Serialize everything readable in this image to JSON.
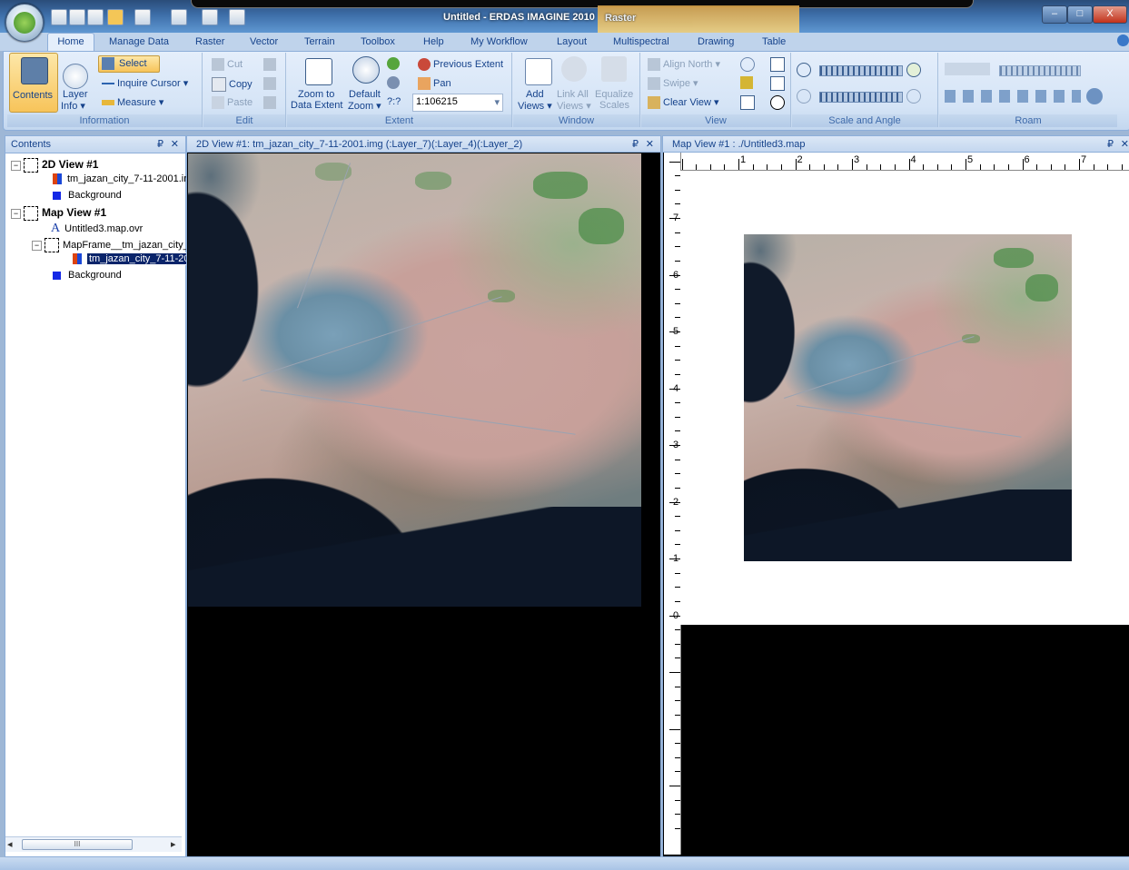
{
  "app": {
    "title": "Untitled - ERDAS IMAGINE 2010",
    "context_tab": "Raster",
    "window_buttons": {
      "minimize": "–",
      "maximize": "□",
      "close": "X"
    }
  },
  "tabs": [
    "Home",
    "Manage Data",
    "Raster",
    "Vector",
    "Terrain",
    "Toolbox",
    "Help",
    "My Workflow",
    "Layout",
    "Multispectral",
    "Drawing",
    "Table"
  ],
  "ribbon": {
    "information": {
      "label": "Information",
      "contents": "Contents",
      "layer_info_1": "Layer",
      "layer_info_2": "Info ▾",
      "select": "Select",
      "inquire_cursor": "Inquire Cursor ▾",
      "measure": "Measure ▾"
    },
    "edit": {
      "label": "Edit",
      "cut": "Cut",
      "copy": "Copy",
      "paste": "Paste"
    },
    "extent": {
      "label": "Extent",
      "zoom_to_1": "Zoom to",
      "zoom_to_2": "Data Extent",
      "default_zoom_1": "Default",
      "default_zoom_2": "Zoom ▾",
      "previous_extent": "Previous Extent",
      "pan": "Pan",
      "scale_prefix": "?:?",
      "scale_value": "1:106215"
    },
    "window": {
      "label": "Window",
      "add_views_1": "Add",
      "add_views_2": "Views ▾",
      "link_all_1": "Link All",
      "link_all_2": "Views ▾",
      "equalize_1": "Equalize",
      "equalize_2": "Scales"
    },
    "view": {
      "label": "View",
      "align_north": "Align North ▾",
      "swipe": "Swipe ▾",
      "clear_view": "Clear View ▾"
    },
    "scale_and_angle": {
      "label": "Scale and Angle"
    },
    "roam": {
      "label": "Roam"
    }
  },
  "contents": {
    "title": "Contents",
    "pin": "₽",
    "close": "✕",
    "tree": [
      {
        "label": "2D View #1",
        "kind": "view"
      },
      {
        "label": "tm_jazan_city_7-11-2001.ir",
        "kind": "layer"
      },
      {
        "label": "Background",
        "kind": "background"
      },
      {
        "label": "Map View #1",
        "kind": "view"
      },
      {
        "label": "Untitled3.map.ovr",
        "kind": "annotation"
      },
      {
        "label": "MapFrame__tm_jazan_city_",
        "kind": "frame"
      },
      {
        "label": "tm_jazan_city_7-11-20",
        "kind": "layer-selected"
      },
      {
        "label": "Background",
        "kind": "background"
      }
    ],
    "scroll_label": "III"
  },
  "view2d": {
    "title": "2D View #1: tm_jazan_city_7-11-2001.img (:Layer_7)(:Layer_4)(:Layer_2)",
    "pin": "₽",
    "close": "✕"
  },
  "mapview": {
    "title": "Map View #1 : ./Untitled3.map",
    "pin": "₽",
    "close": "✕",
    "ruler_x_labels": [
      "1",
      "2",
      "3",
      "4",
      "5",
      "6",
      "7"
    ],
    "ruler_y_labels": [
      "7",
      "6",
      "5",
      "4",
      "3",
      "2",
      "1",
      "0"
    ]
  },
  "colors": {
    "ribbon": "#d5e4f6",
    "accent": "#15428b",
    "selected": "#0a246a"
  }
}
